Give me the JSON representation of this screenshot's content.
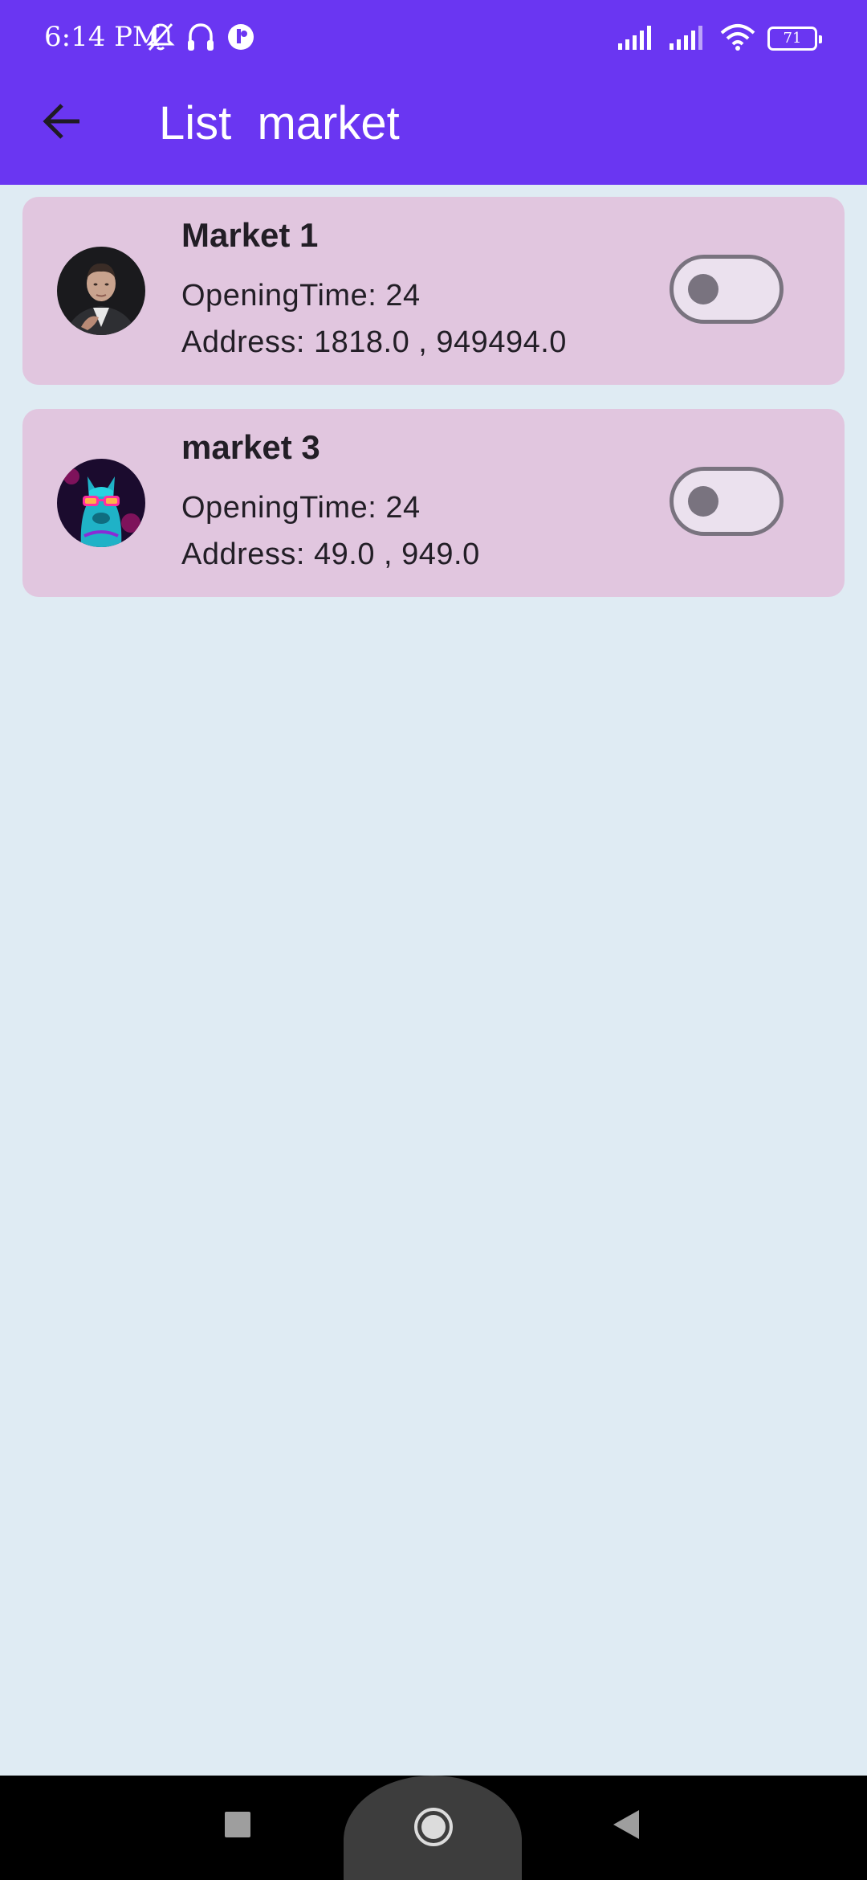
{
  "status_bar": {
    "time": "6:14 PM",
    "left_icons": [
      "bell-off-icon",
      "headphones-icon",
      "app-notification-icon"
    ],
    "right_icons": [
      "signal-icon",
      "signal-icon",
      "wifi-icon"
    ],
    "battery_level": "71"
  },
  "app_bar": {
    "title": "List  market",
    "background": "#6a36f2",
    "back_icon": "arrow-left-icon"
  },
  "markets": [
    {
      "name": "Market 1",
      "opening_time": "OpeningTime: 24",
      "address": "Address: 1818.0 , 949494.0",
      "avatar": "person-photo-avatar",
      "toggle_on": false
    },
    {
      "name": "market 3",
      "opening_time": "OpeningTime: 24",
      "address": "Address: 49.0 , 949.0",
      "avatar": "llama-sunglasses-avatar",
      "toggle_on": false
    }
  ],
  "colors": {
    "page_background": "#dfebf3",
    "card_background": "#e1c6df",
    "toggle_off": "#79737f"
  },
  "nav_bar": {
    "items": [
      "square-recents-icon",
      "circle-home-icon",
      "triangle-back-icon"
    ]
  }
}
